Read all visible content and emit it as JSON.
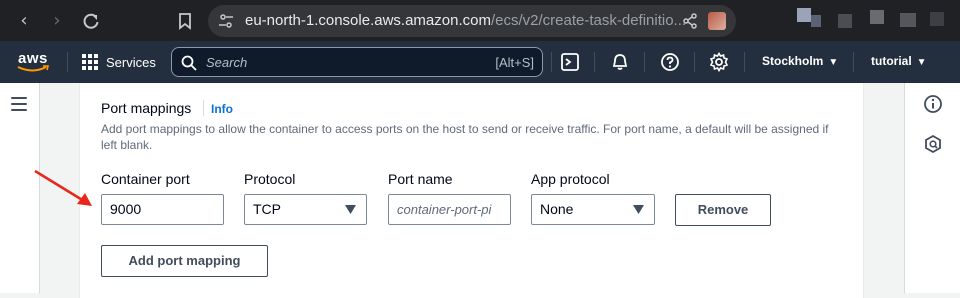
{
  "browser": {
    "url_host": "eu-north-1.console.aws.amazon.com",
    "url_path": "/ecs/v2/create-task-definitio..."
  },
  "aws_nav": {
    "logo": "aws",
    "services_label": "Services",
    "search_placeholder": "Search",
    "search_shortcut": "[Alt+S]",
    "region_label": "Stockholm",
    "account_label": "tutorial",
    "icons": [
      "cloudshell-icon",
      "bell-icon",
      "help-icon",
      "settings-icon"
    ]
  },
  "section": {
    "title": "Port mappings",
    "info_label": "Info",
    "description": "Add port mappings to allow the container to access ports on the host to send or receive traffic. For port name, a default will be assigned if left blank."
  },
  "fields": {
    "container_port_label": "Container port",
    "container_port_value": "9000",
    "protocol_label": "Protocol",
    "protocol_value": "TCP",
    "port_name_label": "Port name",
    "port_name_placeholder": "container-port-pi",
    "app_protocol_label": "App protocol",
    "app_protocol_value": "None"
  },
  "buttons": {
    "remove_label": "Remove",
    "add_port_mapping_label": "Add port mapping"
  },
  "colors": {
    "aws_nav_bg": "#232f3e",
    "info_link": "#0972d3",
    "annotation_arrow": "#e8261c"
  }
}
